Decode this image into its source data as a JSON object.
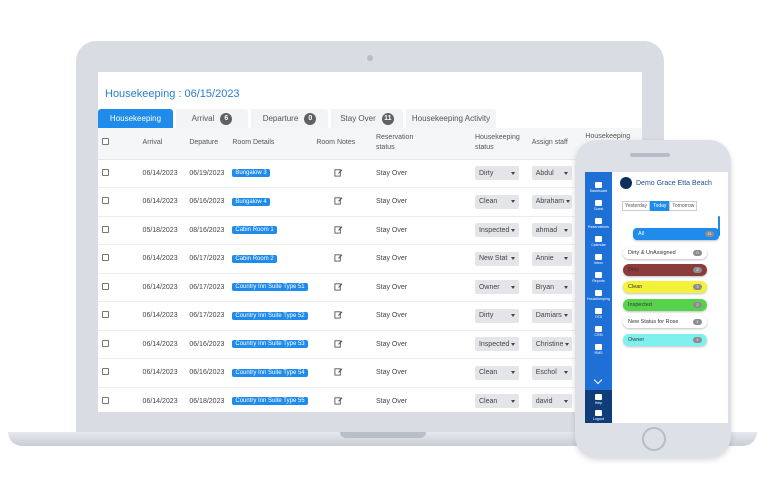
{
  "housekeeping": {
    "title": "Housekeeping : 06/15/2023",
    "tabs": [
      {
        "label": "Housekeeping",
        "count": ""
      },
      {
        "label": "Arrival",
        "count": "6"
      },
      {
        "label": "Departure",
        "count": "0"
      },
      {
        "label": "Stay Over",
        "count": "11"
      },
      {
        "label": "Housekeeping Activity",
        "count": ""
      }
    ],
    "columns": {
      "arrival": "Arrival",
      "departure": "Depature",
      "room_details": "Room Details",
      "room_notes": "Room Notes",
      "reservation_status": "Reservation status",
      "housekeeping_status": "Housekeeping status",
      "assign_staff": "Assign staff",
      "housekeeping": "Housekeeping"
    },
    "rows": [
      {
        "arrival": "06/14/2023",
        "departure": "06/19/2023",
        "room": "Bungalow 3",
        "res_status": "Stay Over",
        "hk_status": "Dirty",
        "staff": "Abdul"
      },
      {
        "arrival": "06/14/2023",
        "departure": "06/16/2023",
        "room": "Bungalow 4",
        "res_status": "Stay Over",
        "hk_status": "Clean",
        "staff": "Abraham"
      },
      {
        "arrival": "05/18/2023",
        "departure": "08/16/2023",
        "room": "Cabin Room 1",
        "res_status": "Stay Over",
        "hk_status": "Inspected",
        "staff": "ahmad"
      },
      {
        "arrival": "06/14/2023",
        "departure": "06/17/2023",
        "room": "Cabin Room 2",
        "res_status": "Stay Over",
        "hk_status": "New Stat",
        "staff": "Annie"
      },
      {
        "arrival": "06/14/2023",
        "departure": "06/17/2023",
        "room": "Country Inn Suite Type 51",
        "res_status": "Stay Over",
        "hk_status": "Owner",
        "staff": "Bryan"
      },
      {
        "arrival": "06/14/2023",
        "departure": "06/17/2023",
        "room": "Country Inn Suite Type 52",
        "res_status": "Stay Over",
        "hk_status": "Dirty",
        "staff": "Damiars"
      },
      {
        "arrival": "06/14/2023",
        "departure": "06/16/2023",
        "room": "Country Inn Suite Type 53",
        "res_status": "Stay Over",
        "hk_status": "Inspected",
        "staff": "Christine"
      },
      {
        "arrival": "06/14/2023",
        "departure": "06/16/2023",
        "room": "Country Inn Suite Type 54",
        "res_status": "Stay Over",
        "hk_status": "Clean",
        "staff": "Eschol"
      },
      {
        "arrival": "06/14/2023",
        "departure": "06/18/2023",
        "room": "Country Inn Suite Type 55",
        "res_status": "Stay Over",
        "hk_status": "Clean",
        "staff": "david"
      }
    ]
  },
  "mobile": {
    "hotel_name": "Demo Grace Etta Beach",
    "sidebar": [
      {
        "label": "Dashboard",
        "icon": "dashboard-icon"
      },
      {
        "label": "Guest",
        "icon": "guest-icon"
      },
      {
        "label": "Reservations",
        "icon": "reservations-icon"
      },
      {
        "label": "Calendar",
        "icon": "calendar-icon"
      },
      {
        "label": "Inbox",
        "icon": "inbox-icon"
      },
      {
        "label": "Reports",
        "icon": "reports-icon"
      },
      {
        "label": "Housekeeping",
        "icon": "housekeeping-icon"
      },
      {
        "label": "OTA",
        "icon": "ota-icon"
      },
      {
        "label": "CRM",
        "icon": "crm-icon"
      },
      {
        "label": "RMS",
        "icon": "rms-icon"
      }
    ],
    "sidebar_bottom": [
      {
        "label": "Help",
        "icon": "help-icon"
      },
      {
        "label": "Logout",
        "icon": "logout-icon"
      }
    ],
    "day_tabs": [
      {
        "label": "Yesterday"
      },
      {
        "label": "Today"
      },
      {
        "label": "Tomorrow"
      }
    ],
    "filters": [
      {
        "label": "All",
        "count": "11",
        "color": "#1f8bea"
      },
      {
        "label": "Dirty & UnAssigned",
        "count": "0",
        "color": "#ffffff"
      },
      {
        "label": "Dirty",
        "count": "2",
        "color": "#8a3b3b"
      },
      {
        "label": "Clean",
        "count": "3",
        "color": "#f4f13a"
      },
      {
        "label": "Inspected",
        "count": "2",
        "color": "#57d34b"
      },
      {
        "label": "New Status for Rose",
        "count": "1",
        "color": "#ffffff"
      },
      {
        "label": "Owner",
        "count": "1",
        "color": "#7ff0f0"
      }
    ]
  }
}
